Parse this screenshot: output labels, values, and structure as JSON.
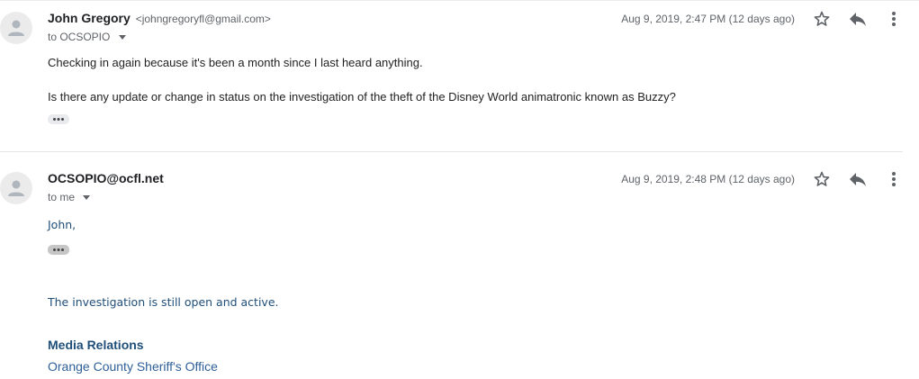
{
  "messages": [
    {
      "sender_name": "John Gregory",
      "sender_email": "<johngregoryfl@gmail.com>",
      "recipient": "to OCSOPIO",
      "date": "Aug 9, 2019, 2:47 PM (12 days ago)",
      "body": [
        "Checking in again because it's been a month since I last heard anything.",
        "Is there any update or change in status on the investigation of the theft of the Disney World animatronic known as Buzzy?"
      ]
    },
    {
      "sender_name": "OCSOPIO@ocfl.net",
      "recipient": "to me",
      "date": "Aug 9, 2019, 2:48 PM (12 days ago)",
      "greeting": "John,",
      "status": "The investigation is still open and active.",
      "signature_title": "Media Relations",
      "signature_org": "Orange County Sheriff's Office"
    }
  ],
  "icons": {
    "avatar": "person-icon",
    "star": "star-icon",
    "reply": "reply-icon",
    "more": "more-vert-icon",
    "caret": "caret-down-icon",
    "show_trimmed": "ellipsis-icon"
  },
  "colors": {
    "signature_blue": "#1f4e79",
    "meta_gray": "#5f6368",
    "text": "#222222"
  }
}
